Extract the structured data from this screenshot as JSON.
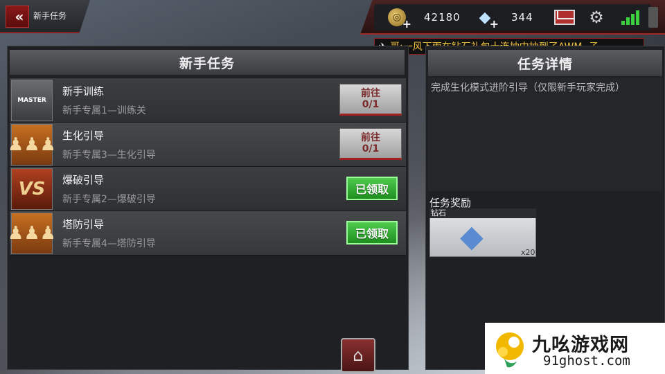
{
  "header": {
    "back_label": "«",
    "page_tab": "新手任务"
  },
  "resources": {
    "gold": "42180",
    "diamonds": "344",
    "gold_icon": "gold-coin-icon",
    "diamond_icon": "diamond-icon"
  },
  "ticker": {
    "text": "哥:一风下雨在钻石礼包十连抽中抽到了AWM -子"
  },
  "task_panel": {
    "title": "新手任务",
    "tasks": [
      {
        "title": "新手训练",
        "subtitle": "新手专属1—训练关",
        "thumb": "MASTER",
        "status": "go",
        "btn_label": "前往",
        "progress": "0/1"
      },
      {
        "title": "生化引导",
        "subtitle": "新手专属3—生化引导",
        "thumb": "",
        "status": "go",
        "btn_label": "前往",
        "progress": "0/1"
      },
      {
        "title": "爆破引导",
        "subtitle": "新手专属2—爆破引导",
        "thumb": "VS",
        "status": "claimed",
        "btn_label": "已领取"
      },
      {
        "title": "塔防引导",
        "subtitle": "新手专属4—塔防引导",
        "thumb": "",
        "status": "claimed",
        "btn_label": "已领取"
      }
    ]
  },
  "detail_panel": {
    "title": "任务详情",
    "description": "完成生化模式进阶引导（仅限新手玩家完成）",
    "reward_label": "任务奖励",
    "reward": {
      "name": "钻石",
      "count": "x20"
    }
  },
  "watermark": {
    "title": "九吆游戏网",
    "url": "91ghost.com"
  },
  "colors": {
    "accent_red": "#8b1e1e",
    "claimed_green": "#2faa2f",
    "ticker_text": "#f0c040"
  }
}
